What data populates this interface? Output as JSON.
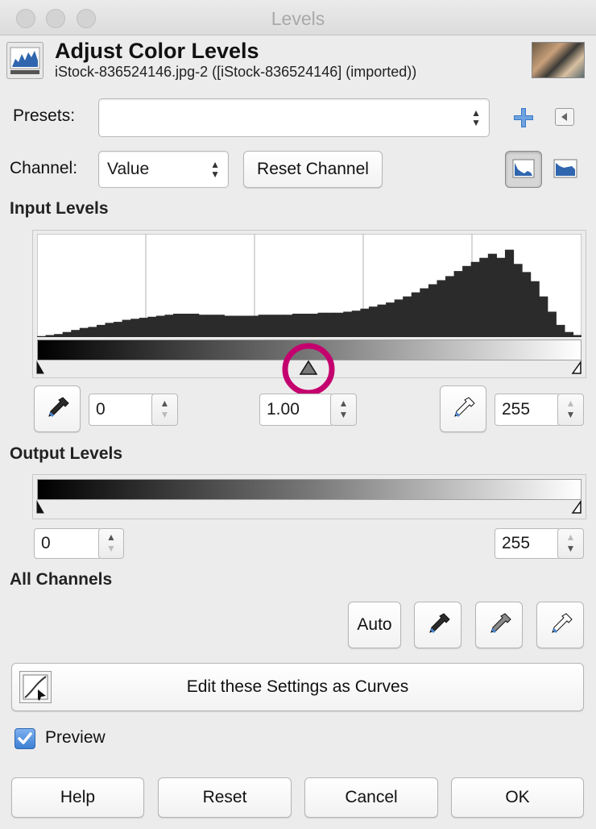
{
  "window": {
    "title": "Levels"
  },
  "header": {
    "title": "Adjust Color Levels",
    "subtitle": "iStock-836524146.jpg-2 ([iStock-836524146] (imported))",
    "icon": "levels-histogram-icon"
  },
  "presets": {
    "label": "Presets:",
    "value": ""
  },
  "channel": {
    "label": "Channel:",
    "value": "Value",
    "reset_label": "Reset Channel"
  },
  "input_levels": {
    "heading": "Input Levels",
    "black": "0",
    "gamma": "1.00",
    "white": "255",
    "histogram_bins": [
      0.01,
      0.02,
      0.03,
      0.05,
      0.07,
      0.09,
      0.1,
      0.12,
      0.14,
      0.15,
      0.17,
      0.18,
      0.19,
      0.2,
      0.21,
      0.22,
      0.23,
      0.23,
      0.23,
      0.22,
      0.22,
      0.22,
      0.21,
      0.21,
      0.21,
      0.21,
      0.22,
      0.22,
      0.22,
      0.22,
      0.23,
      0.23,
      0.23,
      0.24,
      0.24,
      0.24,
      0.25,
      0.26,
      0.28,
      0.3,
      0.32,
      0.34,
      0.37,
      0.4,
      0.44,
      0.48,
      0.52,
      0.56,
      0.6,
      0.65,
      0.7,
      0.74,
      0.78,
      0.82,
      0.78,
      0.86,
      0.72,
      0.64,
      0.55,
      0.4,
      0.25,
      0.12,
      0.05,
      0.02
    ],
    "histogram_peak": 1.0
  },
  "output_levels": {
    "heading": "Output Levels",
    "black": "0",
    "white": "255"
  },
  "all_channels": {
    "heading": "All Channels",
    "auto_label": "Auto"
  },
  "curves_button": {
    "label": "Edit these Settings as Curves"
  },
  "preview": {
    "label": "Preview",
    "checked": true
  },
  "footer": {
    "help": "Help",
    "reset": "Reset",
    "cancel": "Cancel",
    "ok": "OK"
  },
  "colors": {
    "accent": "#3a79c6",
    "highlight_ring": "#c4006e"
  }
}
